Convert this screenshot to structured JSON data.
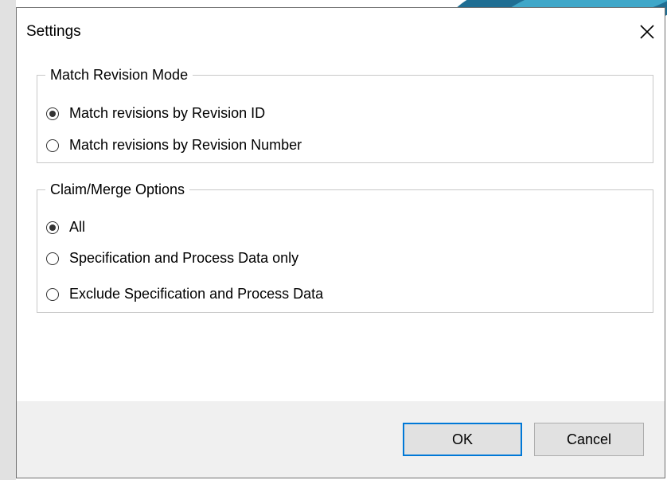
{
  "dialog": {
    "title": "Settings",
    "close_icon": "close-icon"
  },
  "match_revision_mode": {
    "legend": "Match Revision Mode",
    "options": [
      {
        "label": "Match revisions by Revision ID",
        "checked": true
      },
      {
        "label": "Match revisions by Revision Number",
        "checked": false
      }
    ]
  },
  "claim_merge_options": {
    "legend": "Claim/Merge Options",
    "options": [
      {
        "label": "All",
        "checked": true
      },
      {
        "label": "Specification and Process Data only",
        "checked": false
      },
      {
        "label": "Exclude Specification and Process Data",
        "checked": false
      }
    ]
  },
  "buttons": {
    "ok_label": "OK",
    "cancel_label": "Cancel"
  },
  "colors": {
    "focus_border": "#0078d7",
    "footer_bg": "#f0f0f0",
    "button_bg": "#e1e1e1"
  }
}
